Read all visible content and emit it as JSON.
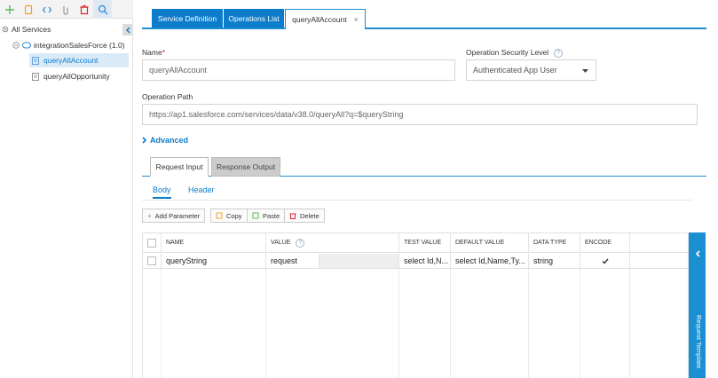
{
  "toolbar": {
    "icons": [
      "plus-icon",
      "document-icon",
      "code-icon",
      "link-icon",
      "trash-icon",
      "search-icon"
    ]
  },
  "tree": {
    "root": "All Services",
    "service": "integrationSalesForce (1.0)",
    "operations": [
      "queryAllAccount",
      "queryAllOpportunity"
    ],
    "selected": "queryAllAccount"
  },
  "tabs": {
    "service_definition": "Service Definition",
    "operations_list": "Operations List",
    "active": "queryAllAccount",
    "close": "×"
  },
  "form": {
    "name_label": "Name",
    "required_mark": "*",
    "name_value": "queryAllAccount",
    "security_label": "Operation Security Level",
    "help_glyph": "?",
    "security_value": "Authenticated App User",
    "path_label": "Operation Path",
    "path_value": "https://ap1.salesforce.com/services/data/v38.0/queryAll?q=$queryString",
    "advanced": "Advanced"
  },
  "subtabs": {
    "request": "Request Input",
    "response": "Response Output"
  },
  "body_tabs": {
    "body": "Body",
    "header": "Header"
  },
  "actions": {
    "add": "Add Parameter",
    "copy": "Copy",
    "paste": "Paste",
    "delete": "Delete"
  },
  "table": {
    "columns": [
      "NAME",
      "VALUE",
      "TEST VALUE",
      "DEFAULT VALUE",
      "DATA TYPE",
      "ENCODE"
    ],
    "rows": [
      {
        "name": "queryString",
        "value": "request",
        "test_value": "select Id,N...",
        "default_value": "select Id,Name,Ty...",
        "data_type": "string",
        "encode": true
      }
    ]
  },
  "right_panel": {
    "label": "Request Template"
  },
  "colors": {
    "accent": "#0d7ccb",
    "selection": "#dbeaf7"
  }
}
